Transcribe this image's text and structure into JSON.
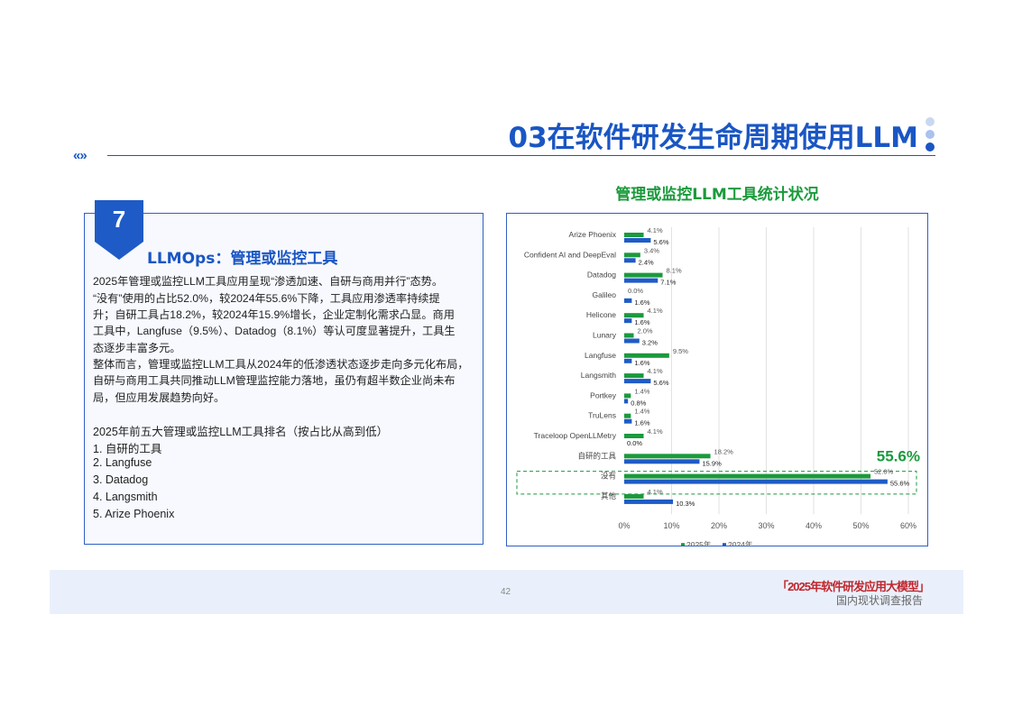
{
  "header": {
    "title": "03在软件研发生命周期使用LLM",
    "chevrons": "«»"
  },
  "left_panel": {
    "badge_number": "7",
    "subtitle": "LLMOps：管理或监控工具",
    "paragraphs": [
      "2025年管理或监控LLM工具应用呈现“渗透加速、自研与商用并行”态势。",
      "“没有”使用的占比52.0%，较2024年55.6%下降，工具应用渗透率持续提",
      "升；自研工具占18.2%，较2024年15.9%增长，企业定制化需求凸显。商用",
      "工具中，Langfuse（9.5%）、Datadog（8.1%）等认可度显著提升，工具生",
      "态逐步丰富多元。",
      "整体而言，管理或监控LLM工具从2024年的低渗透状态逐步走向多元化布局，",
      "自研与商用工具共同推动LLM管理监控能力落地，虽仍有超半数企业尚未布",
      "局，但应用发展趋势向好。"
    ],
    "ranking_title": "2025年前五大管理或监控LLM工具排名（按占比从高到低）",
    "ranking": [
      "1.  自研的工具",
      "2.   Langfuse",
      "3.  Datadog",
      "4.  Langsmith",
      "5.  Arize Phoenix"
    ]
  },
  "chart_data": {
    "type": "bar",
    "orientation": "horizontal",
    "title": "管理或监控LLM工具统计状况",
    "categories": [
      "Arize Phoenix",
      "Confident AI and DeepEval",
      "Datadog",
      "Galileo",
      "Helicone",
      "Lunary",
      "Langfuse",
      "Langsmith",
      "Portkey",
      "TruLens",
      "Traceloop OpenLLMetry",
      "自研的工具",
      "没有",
      "其他"
    ],
    "series": [
      {
        "name": "2025年",
        "color": "#1a9a3c",
        "values": [
          4.1,
          3.4,
          8.1,
          0.0,
          4.1,
          2.0,
          9.5,
          4.1,
          1.4,
          1.4,
          4.1,
          18.2,
          52.0,
          4.1
        ],
        "labels": [
          "4.1%",
          "3.4%",
          "8.1%",
          "0.0%",
          "4.1%",
          "2.0%",
          "9.5%",
          "4.1%",
          "1.4%",
          "1.4%",
          "4.1%",
          "18.2%",
          "52.0%",
          "4.1%"
        ]
      },
      {
        "name": "2024年",
        "color": "#1f5bc6",
        "values": [
          5.6,
          2.4,
          7.1,
          1.6,
          1.6,
          3.2,
          1.6,
          5.6,
          0.8,
          1.6,
          0.0,
          15.9,
          55.6,
          10.3
        ],
        "labels": [
          "5.6%",
          "2.4%",
          "7.1%",
          "1.6%",
          "1.6%",
          "3.2%",
          "1.6%",
          "5.6%",
          "0.8%",
          "1.6%",
          "0.0%",
          "15.9%",
          "55.6%",
          "10.3%"
        ]
      }
    ],
    "xlim": [
      0,
      60
    ],
    "xticks": [
      "0%",
      "10%",
      "20%",
      "30%",
      "40%",
      "50%",
      "60%"
    ],
    "grid": true,
    "legend": "bottom",
    "highlight": {
      "category": "没有",
      "label": "55.6%"
    }
  },
  "footer": {
    "page_number": "42",
    "report_title": "「2025年软件研发应用大模型」",
    "report_subtitle": "国内现状调查报告"
  },
  "colors": {
    "brand": "#1a56c4",
    "green": "#1a9a3c",
    "accent_red": "#c0262d"
  }
}
